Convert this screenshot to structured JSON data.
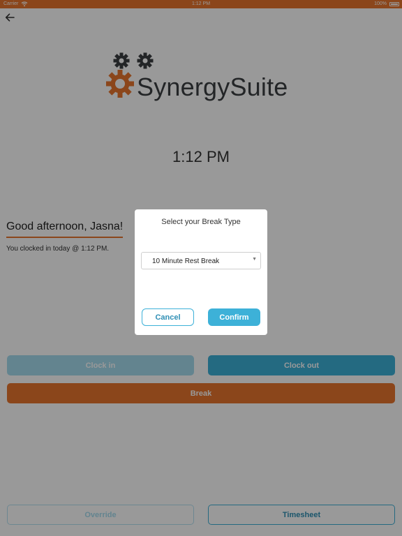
{
  "status_bar": {
    "carrier": "Carrier",
    "time": "1:12 PM",
    "battery": "100%"
  },
  "header": {
    "back_icon": "arrow-left-icon"
  },
  "brand": {
    "logo_text": "SynergySuite",
    "logo_icon": "gears-icon",
    "accent_color": "#e8762d",
    "dark_gear_color": "#3b3f42"
  },
  "clock": {
    "time": "1:12 PM"
  },
  "greeting": {
    "title": "Good afternoon, Jasna!",
    "subtitle": "You clocked in today @ 1:12 PM."
  },
  "actions": {
    "clock_in": "Clock in",
    "clock_out": "Clock out",
    "break": "Break",
    "override": "Override",
    "timesheet": "Timesheet"
  },
  "dialog": {
    "title": "Select your Break Type",
    "selected_break": "10 Minute Rest Break",
    "cancel": "Cancel",
    "confirm": "Confirm"
  },
  "colors": {
    "primary_blue": "#3db1d8",
    "disabled_blue": "#a6dcef",
    "orange": "#e8762d"
  }
}
